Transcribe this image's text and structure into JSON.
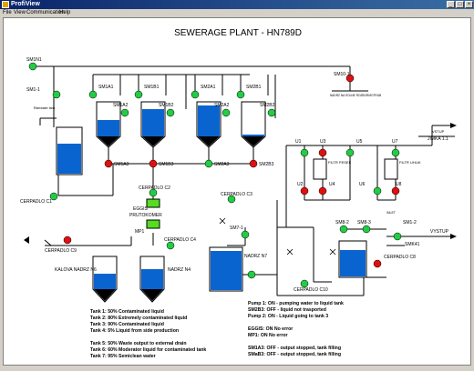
{
  "window": {
    "title": "ProfiView",
    "menus": [
      "File",
      "View",
      "Communication",
      "Help"
    ]
  },
  "heading": "SEWERAGE     PLANT   -  HN789D",
  "colors": {
    "pipe": "#000000",
    "water": "#0a64d0",
    "valve_open": "#22cc44",
    "valve_closed": "#e01010",
    "module": "#55dd22"
  },
  "labels": {
    "sm1n1": "SM1N1",
    "sm1_1": "SM1-1",
    "sm1a1": "SM1A1",
    "sm1b1": "SM1B1",
    "sm2a1": "SM2A1",
    "sm2b1": "SM2B1",
    "sm1a2": "SM1A2",
    "sm1b2": "SM1B2",
    "sm2a2": "SM2A2",
    "sm2b2": "SM2B2",
    "sm1a3": "SM1A3",
    "sm1b3": "SM1B3",
    "sm2a3": "SM2A3",
    "sm2b3": "SM2B3",
    "sm10_1": "SM10-1",
    "nadrz_note": "NADRZ NA SOLNE ROZBORMOTRUB",
    "rainwater": "Rainwater tank",
    "cerpadlo_c1": "CERPADLO C1",
    "cerpadlo_c2": "CERPADLO C2",
    "cerpadlo_c3": "CERPADLO C3",
    "cerpadlo_c4": "CERPADLO C4",
    "cerpadlo_c8": "CERPADLO C8",
    "cerpadlo_c9": "CERPADLO C9",
    "cerpadlo_c10": "CERPADLO C10",
    "eggis": "EGGIS",
    "prutokomer": "PRUTOKOMER",
    "mp1": "MP1",
    "kalova_nadrz": "KALOVA NADRZ N6",
    "nadrz_n4": "NADRZ N4",
    "nadrz_n7": "NADRZ N7",
    "sm7_1": "SM7-1",
    "sm8_2": "SM8-2",
    "sm8_3": "SM8-3",
    "sm1_2": "SM1-2",
    "smk41": "SMK41",
    "u1": "U1",
    "u2": "U2",
    "u3": "U3",
    "u4": "U4",
    "u5": "U5",
    "u6": "U6",
    "u7": "U7",
    "u8": "U8",
    "filtr1": "FILTR PESEK",
    "filtr2": "FILTR UHLIK",
    "vstup": "VSTUP",
    "jimka": "JIMKA 1.1",
    "vystup": "VYSTUP",
    "inlet": "INLET"
  },
  "legend_tanks": [
    "Tank 1:  50%  Contaminated liquid",
    "Tank 2:  80%  Extremely contaminated liquid",
    "Tank 3:  90%  Contaminated liquid",
    "Tank 4:     5%  Liquid from side production",
    "",
    "Tank 5:  50%  Waste output to external drain",
    "Tank 6:  60%  Moderator liquid for contaminated tank",
    "Tank 7:  95%  Semiclean water"
  ],
  "legend_status": [
    "Pump 1:    ON  - pumping water to liquid tank",
    "SM2B3:     OFF  - liquid not trasported",
    "Pump 2:    ON  - Liquid going to tank 3",
    "",
    "EGGIS:     ON  No error",
    "MP1:         ON  No error",
    "",
    "SM1A3:     OFF - output stopped, tank filling",
    "SMaB3:     OFF - output stopped, tank filling"
  ],
  "tank_levels": {
    "tank1": 0.5,
    "tank2": 0.8,
    "tank3": 0.9,
    "tank4": 0.05,
    "tank5": 0.5,
    "tank6": 0.6,
    "tank7": 0.95,
    "rain": 0.55,
    "tank8": 0.75
  }
}
